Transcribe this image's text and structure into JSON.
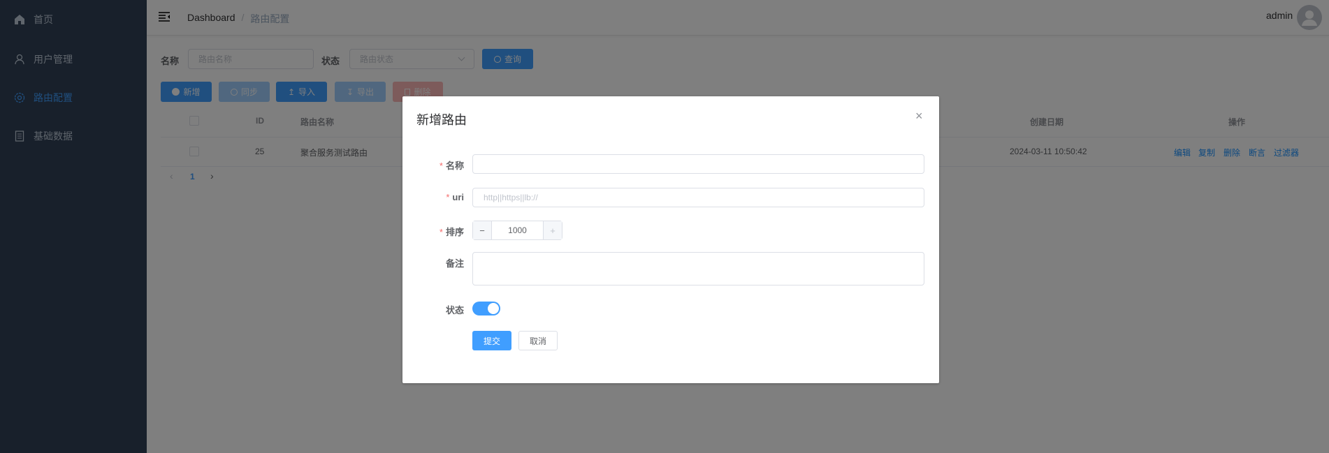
{
  "sidebar": {
    "items": [
      {
        "label": "首页",
        "icon": "home-icon"
      },
      {
        "label": "用户管理",
        "icon": "user-icon"
      },
      {
        "label": "路由配置",
        "icon": "gear-icon",
        "active": true
      },
      {
        "label": "基础数据",
        "icon": "document-icon"
      }
    ]
  },
  "header": {
    "breadcrumb": [
      "Dashboard",
      "路由配置"
    ],
    "separator": "/",
    "username": "admin"
  },
  "filter": {
    "name_label": "名称",
    "name_placeholder": "路由名称",
    "status_label": "状态",
    "status_placeholder": "路由状态",
    "search_label": "查询"
  },
  "toolbar": {
    "add": "新增",
    "sync": "同步",
    "import": "导入",
    "export": "导出",
    "delete": "删除"
  },
  "table": {
    "headers": {
      "id": "ID",
      "name": "路由名称",
      "created": "创建日期",
      "actions": "操作"
    },
    "rows": [
      {
        "id": "25",
        "name": "聚合服务测试路由",
        "created": "2024-03-11 10:50:42",
        "actions": [
          "编辑",
          "复制",
          "删除",
          "断言",
          "过滤器"
        ]
      }
    ]
  },
  "pagination": {
    "current": "1"
  },
  "modal": {
    "title": "新增路由",
    "fields": {
      "name_label": "名称",
      "uri_label": "uri",
      "uri_placeholder": "http||https||lb://",
      "order_label": "排序",
      "order_value": "1000",
      "remark_label": "备注",
      "status_label": "状态",
      "status_on": true
    },
    "submit": "提交",
    "cancel": "取消"
  },
  "colors": {
    "primary": "#409eff",
    "sidebar_bg": "#304156",
    "danger": "#f56c6c"
  }
}
